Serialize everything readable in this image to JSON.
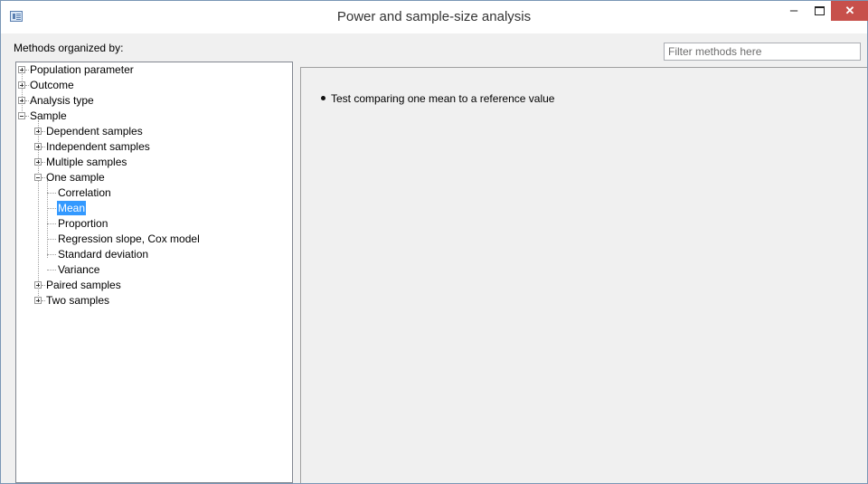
{
  "window": {
    "title": "Power and sample-size analysis",
    "minimize_glyph": "–",
    "close_glyph": "✕"
  },
  "left_panel": {
    "header": "Methods organized by:",
    "tree": [
      {
        "label": "Population parameter",
        "expanded": false,
        "level": 0
      },
      {
        "label": "Outcome",
        "expanded": false,
        "level": 0
      },
      {
        "label": "Analysis type",
        "expanded": false,
        "level": 0
      },
      {
        "label": "Sample",
        "expanded": true,
        "level": 0
      },
      {
        "label": "Dependent samples",
        "expanded": false,
        "level": 1
      },
      {
        "label": "Independent samples",
        "expanded": false,
        "level": 1
      },
      {
        "label": "Multiple samples",
        "expanded": false,
        "level": 1
      },
      {
        "label": "One sample",
        "expanded": true,
        "level": 1
      },
      {
        "label": "Correlation",
        "level": 2
      },
      {
        "label": "Mean",
        "level": 2,
        "selected": true
      },
      {
        "label": "Proportion",
        "level": 2
      },
      {
        "label": "Regression slope, Cox model",
        "level": 2
      },
      {
        "label": "Standard deviation",
        "level": 2
      },
      {
        "label": "Variance",
        "level": 2
      },
      {
        "label": "Paired samples",
        "expanded": false,
        "level": 1
      },
      {
        "label": "Two samples",
        "expanded": false,
        "level": 1
      }
    ]
  },
  "right_panel": {
    "filter_placeholder": "Filter methods here",
    "methods": [
      "Test comparing one mean to a reference value"
    ]
  },
  "colors": {
    "selection": "#3399ff",
    "close_button": "#c7504b"
  }
}
